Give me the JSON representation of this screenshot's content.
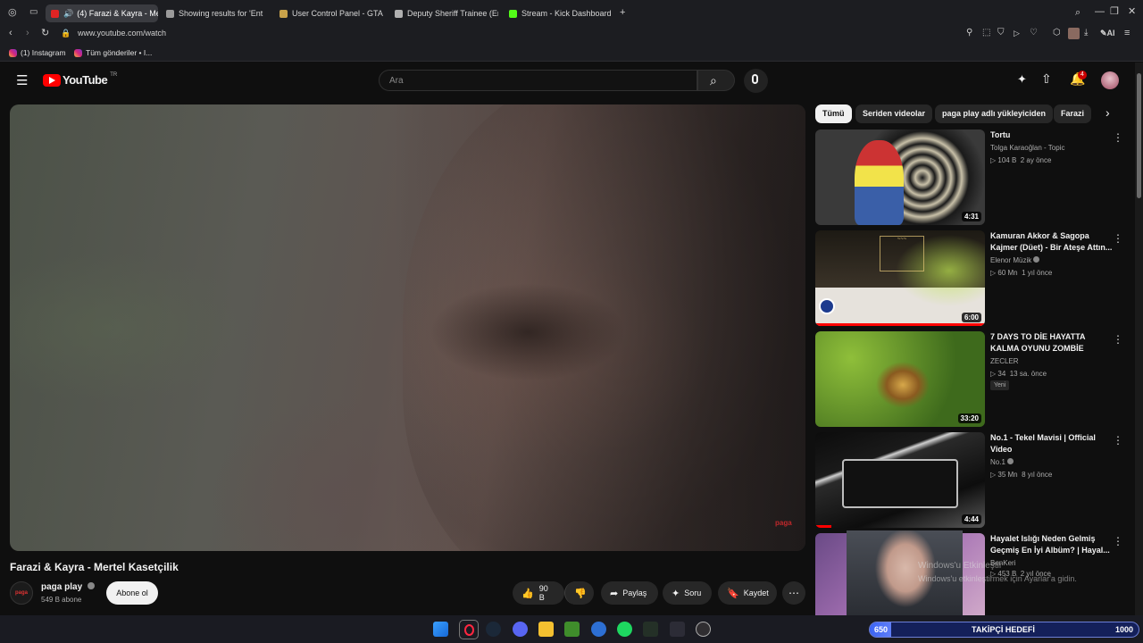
{
  "browser": {
    "tabs": [
      {
        "label": "(4) Farazi & Kayra - Me",
        "active": true,
        "favicon_color": "#e02424"
      },
      {
        "label": "Showing results for 'Ent",
        "active": false,
        "favicon_color": "#9a9a9a"
      },
      {
        "label": "User Control Panel - GTA V",
        "active": false,
        "favicon_color": "#c8a24a"
      },
      {
        "label": "Deputy Sheriff Trainee (Ent",
        "active": false,
        "favicon_color": "#b0b0b0"
      },
      {
        "label": "Stream - Kick Dashboard",
        "active": false,
        "favicon_color": "#53fc18"
      }
    ],
    "url": "www.youtube.com/watch",
    "bookmarks": [
      "(1) Instagram",
      "Tüm gönderiler • I..."
    ],
    "ai_label": "AI"
  },
  "youtube": {
    "logo": "YouTube",
    "country": "TR",
    "search_placeholder": "Ara",
    "notification_count": "4",
    "video": {
      "title": "Farazi & Kayra - Mertel Kasetçilik",
      "watermark": "paga",
      "channel": "paga play",
      "channel_avatar": "paga",
      "subscribers": "549 B abone",
      "subscribe_label": "Abone ol",
      "likes": "90 B",
      "share_label": "Paylaş",
      "ask_label": "Soru",
      "save_label": "Kaydet"
    },
    "chips": [
      "Tümü",
      "Seriden videolar",
      "paga play adlı yükleyiciden",
      "Farazi"
    ],
    "recommendations": [
      {
        "title": "Tortu",
        "channel": "Tolga Karaoğlan - Topic",
        "views": "104 B",
        "age": "2 ay önce",
        "duration": "4:31",
        "verified": false,
        "new": false
      },
      {
        "title": "Kamuran Akkor & Sagopa Kajmer (Düet) - Bir Ateşe Attın...",
        "channel": "Elenor Müzik",
        "views": "60 Mn",
        "age": "1 yıl önce",
        "duration": "6:00",
        "verified": true,
        "new": false
      },
      {
        "title": "7 DAYS TO DİE HAYATTA KALMA OYUNU ZOMBİE",
        "channel": "ZECLER",
        "views": "34",
        "age": "13 sa. önce",
        "duration": "33:20",
        "verified": false,
        "new": true,
        "new_label": "Yeni"
      },
      {
        "title": "No.1 - Tekel Mavisi | Official Video",
        "channel": "No.1",
        "views": "35 Mn",
        "age": "8 yıl önce",
        "duration": "4:44",
        "verified": true,
        "new": false
      },
      {
        "title": "Hayalet Islığı Neden Gelmiş Geçmiş En İyi Albüm? | Hayal...",
        "channel": "BenKeri",
        "views": "453 B",
        "age": "2 yıl önce",
        "duration": "",
        "verified": false,
        "new": false
      }
    ]
  },
  "overlay": {
    "windows_line1": "Windows'u Etkinleştir",
    "windows_line2": "Windows'u etkinleştirmek için Ayarlar'a gidin.",
    "goal_start": "650",
    "goal_label": "TAKİPÇİ HEDEFİ",
    "goal_end": "1000",
    "goal_progress": 0.08
  },
  "colors": {
    "youtube_red": "#ff0000",
    "background": "#0f0f0f",
    "chip_bg": "#272727",
    "goal_blue": "#3b64f5"
  }
}
